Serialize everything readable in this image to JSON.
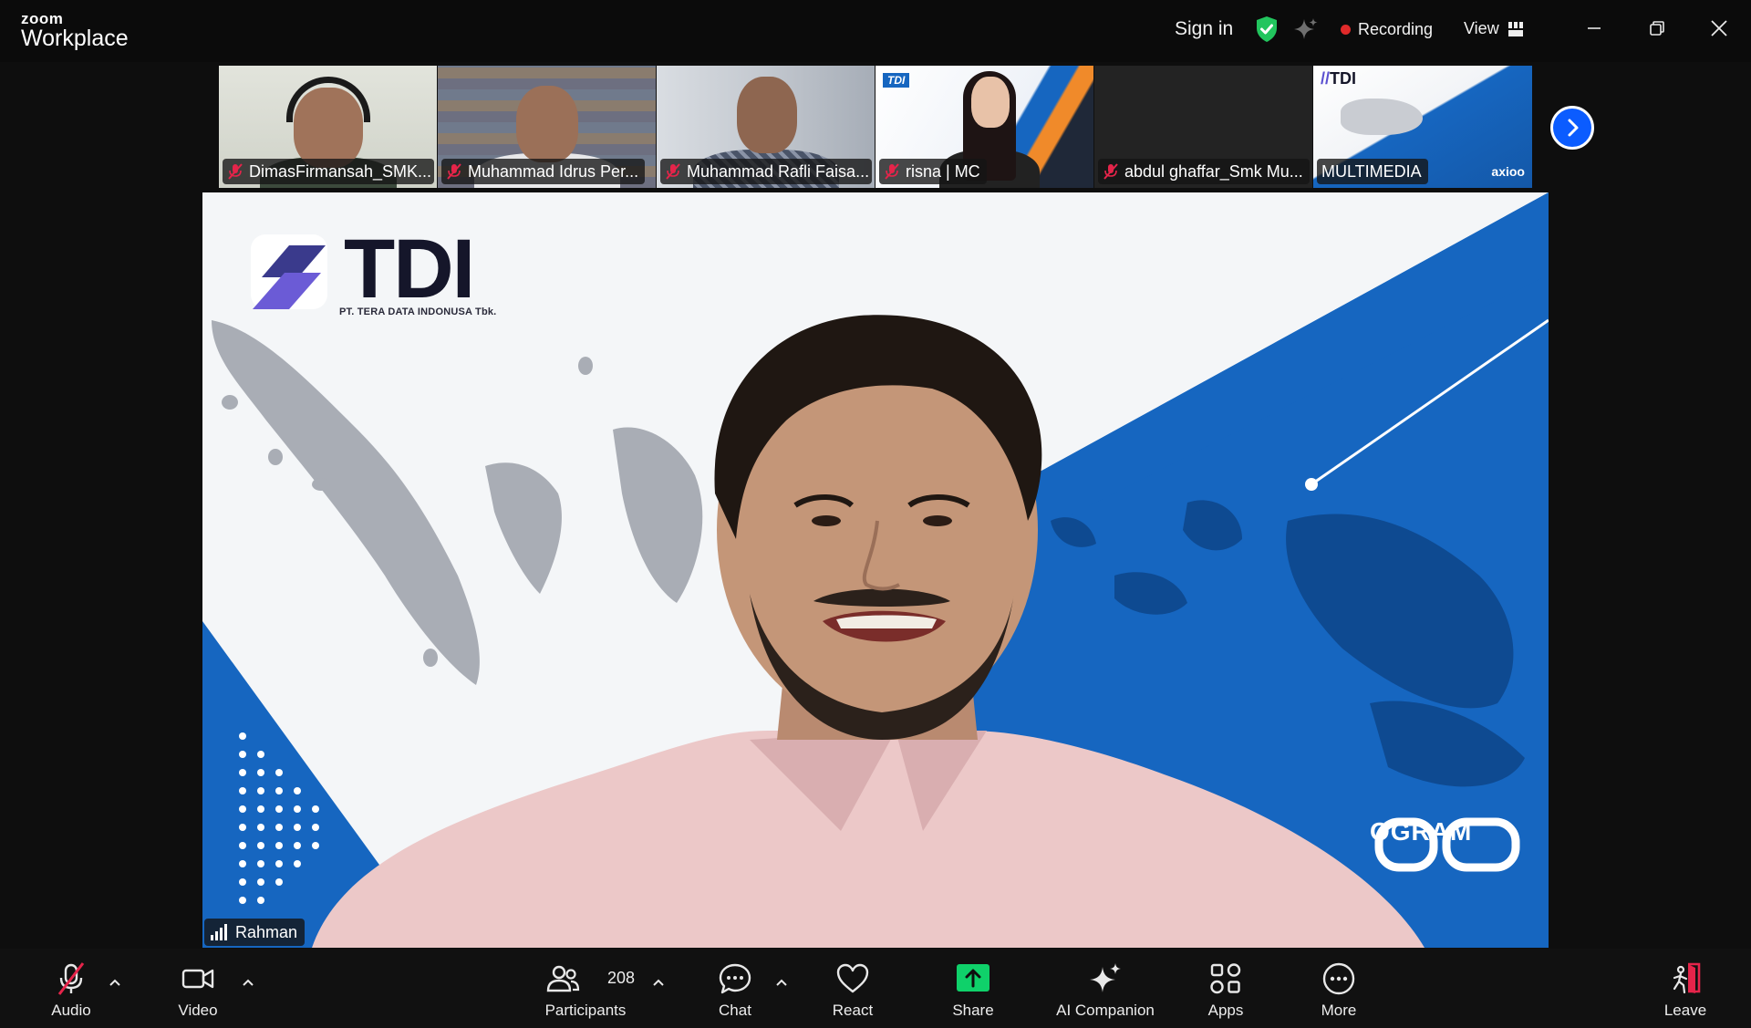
{
  "app": {
    "logo_top": "zoom",
    "logo_bottom": "Workplace"
  },
  "topbar": {
    "sign_in": "Sign in",
    "recording": "Recording",
    "view": "View"
  },
  "participants_strip": [
    {
      "name": "DimasFirmansah_SMK...",
      "muted": true
    },
    {
      "name": "Muhammad Idrus Per...",
      "muted": true
    },
    {
      "name": "Muhammad Rafli Faisa...",
      "muted": true
    },
    {
      "name": "risna | MC",
      "muted": true
    },
    {
      "name": "abdul ghaffar_Smk Mu...",
      "muted": true
    },
    {
      "name": "MULTIMEDIA",
      "muted": false
    }
  ],
  "main_video": {
    "speaker": "Rahman",
    "background_brand": "TDI",
    "background_subtitle": "PT. TERA DATA INDONUSA Tbk.",
    "background_text": "OGRAM"
  },
  "toolbar": {
    "audio": "Audio",
    "video": "Video",
    "participants": "Participants",
    "participants_count": "208",
    "chat": "Chat",
    "react": "React",
    "share": "Share",
    "ai_companion": "AI Companion",
    "apps": "Apps",
    "more": "More",
    "leave": "Leave"
  },
  "colors": {
    "accent_blue": "#0b5cff",
    "share_green": "#0fd16a",
    "recording_red": "#e02a2a",
    "shield_green": "#22c55e",
    "leave_red": "#e5244a",
    "brand_blue": "#1666c0"
  },
  "icons": [
    "shield-check-icon",
    "sparkle-icon",
    "grid-view-icon",
    "minimize-icon",
    "restore-icon",
    "close-icon",
    "mic-muted-icon",
    "chevron-right-icon",
    "signal-icon",
    "camera-icon",
    "participants-icon",
    "chat-icon",
    "heart-icon",
    "share-arrow-icon",
    "ai-sparkle-icon",
    "apps-icon",
    "more-icon",
    "leave-door-icon",
    "caret-up-icon"
  ]
}
